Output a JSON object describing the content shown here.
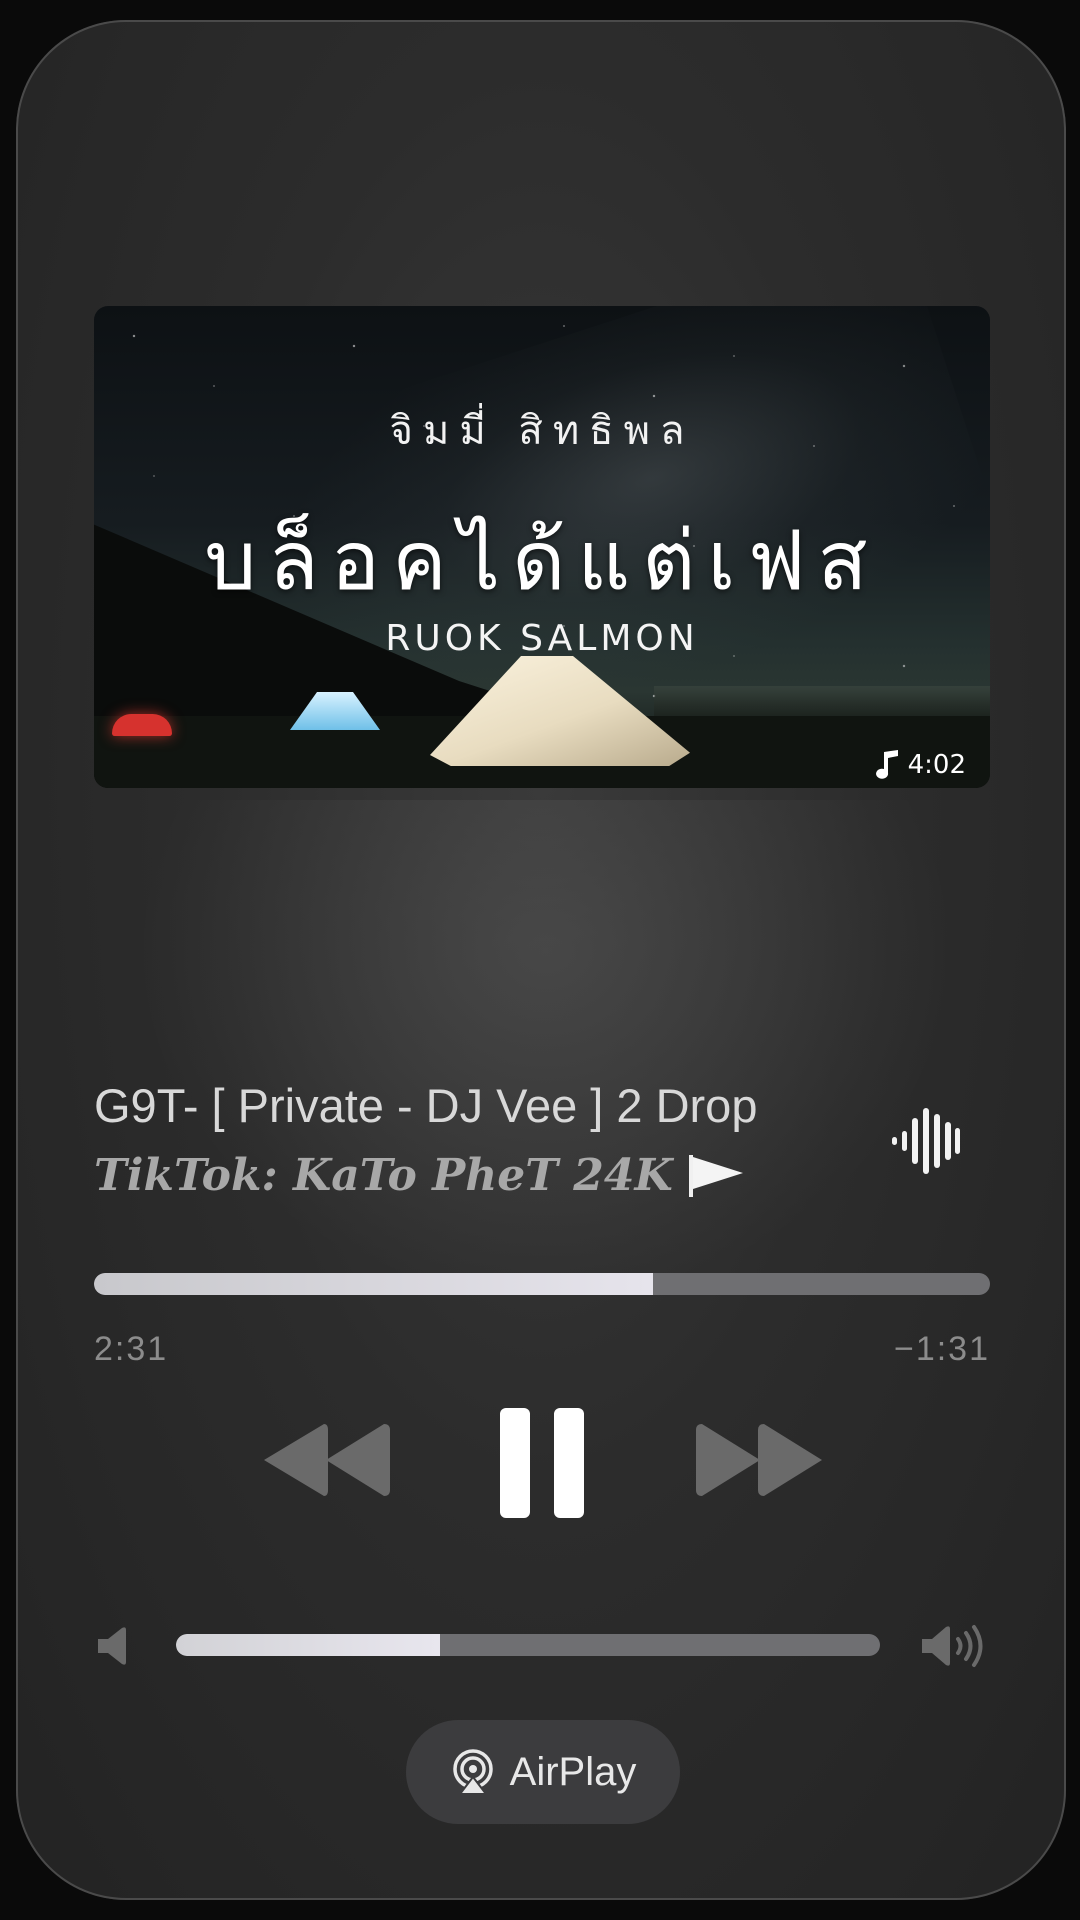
{
  "artwork": {
    "artist_text": "จิมมี่ สิทธิพล",
    "title_text": "บล็อคได้แต่เฟส",
    "subtitle_text": "RUOK SALMON",
    "duration": "4:02"
  },
  "track": {
    "title": "G9T- [ Private - DJ Vee ] 2 Drop",
    "artist": "TikTok: KaTo PheT 24K"
  },
  "playback": {
    "progress_fraction": 0.624,
    "elapsed": "2:31",
    "remaining": "−1:31",
    "state": "playing"
  },
  "volume": {
    "level_fraction": 0.375
  },
  "airplay": {
    "label": "AirPlay"
  },
  "icons": {
    "music_note": "music-note-icon",
    "flag": "flag-icon",
    "waveform": "waveform-icon",
    "rewind": "rewind-icon",
    "pause": "pause-icon",
    "fast_forward": "fast-forward-icon",
    "volume_low": "speaker-low-icon",
    "volume_high": "speaker-high-icon",
    "airplay": "airplay-icon"
  },
  "colors": {
    "accent_fill": "#e6e4ec",
    "track_bg": "#6f6f72",
    "control_dim": "#6a6a6a",
    "control_primary": "#ffffff"
  }
}
